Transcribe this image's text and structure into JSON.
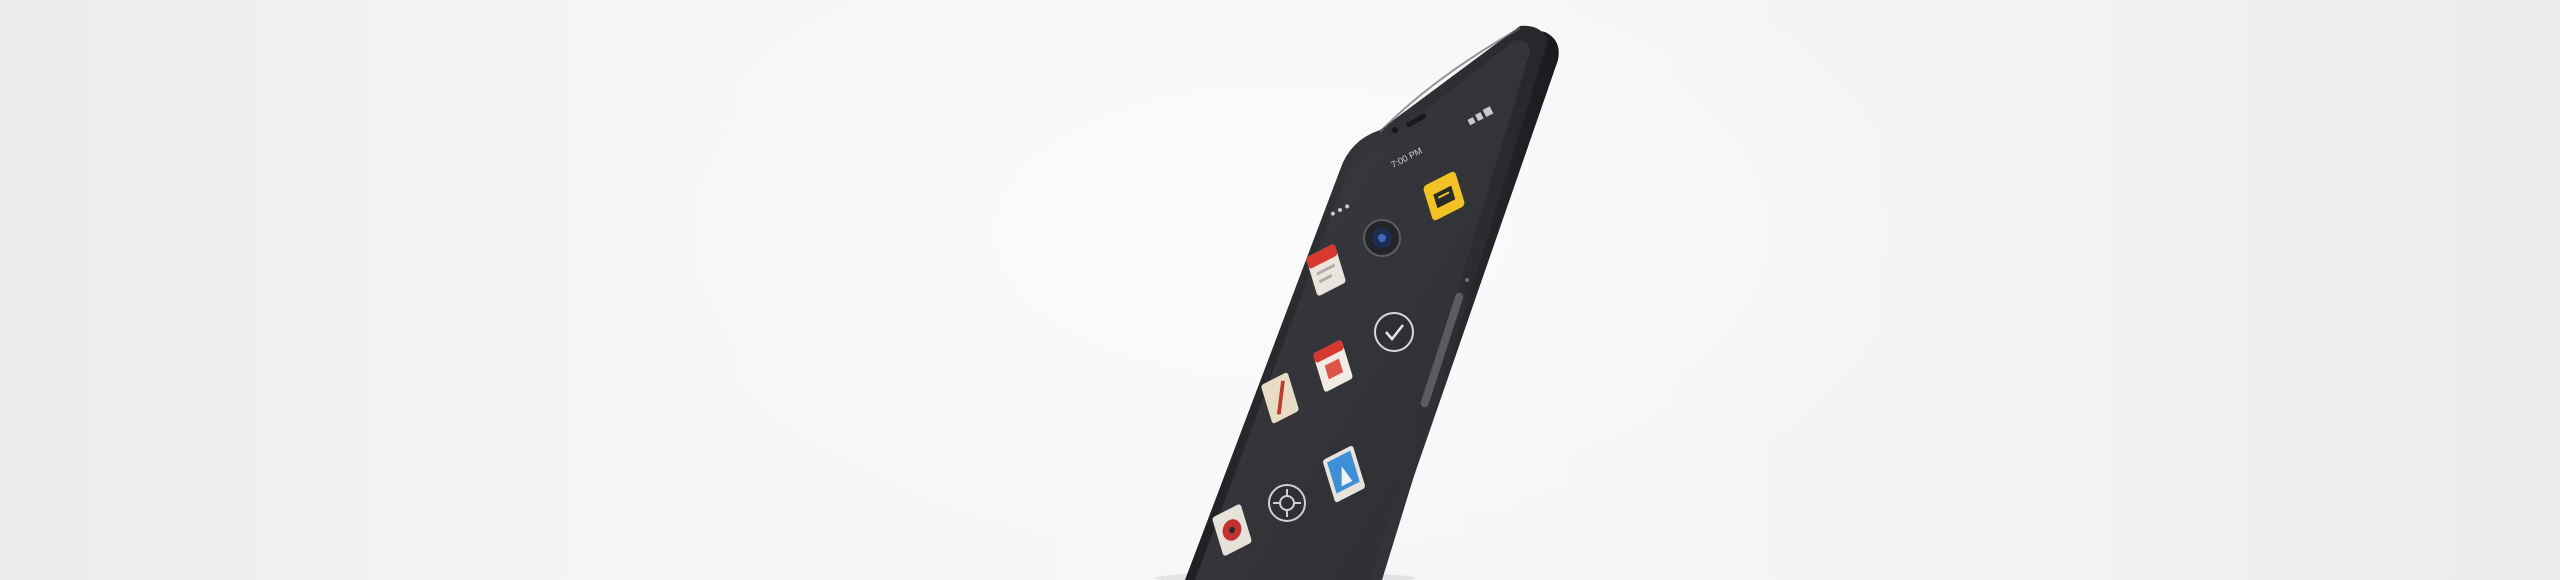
{
  "scene": {
    "subject": "phone",
    "colors": {
      "background_center": "#f8f8f8",
      "background_edge": "#ebebeb",
      "phone_body": "#2e2f33",
      "phone_edge": "#1c1d20",
      "screen": "#34353a",
      "side_button": "#55575c"
    }
  },
  "status_bar": {
    "time": "7:00 PM"
  },
  "home_icons": [
    {
      "name": "notes-app-icon",
      "color": "#f2c224"
    },
    {
      "name": "camera-app-icon",
      "color": "#1d2e52"
    },
    {
      "name": "calendar-app-icon",
      "color": "#d8382e"
    },
    {
      "name": "clock-app-icon",
      "color": "#3a3b40"
    },
    {
      "name": "date-app-icon",
      "color": "#f0ece4"
    },
    {
      "name": "pencil-app-icon",
      "color": "#e8dcc4"
    },
    {
      "name": "weather-app-icon",
      "color": "#3d8fd6"
    },
    {
      "name": "settings-app-icon",
      "color": "#3a3b40"
    },
    {
      "name": "music-app-icon",
      "color": "#c23030"
    }
  ]
}
